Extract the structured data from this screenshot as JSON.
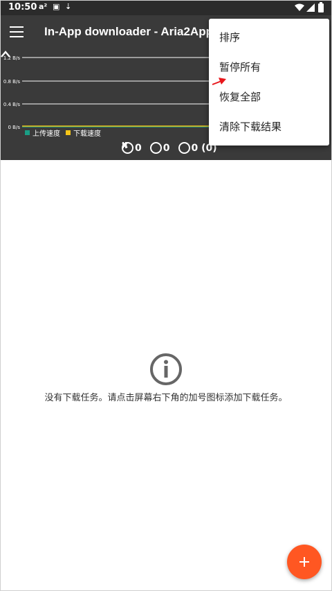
{
  "status_bar": {
    "time": "10:50",
    "icons": [
      "a2-icon",
      "font-icon",
      "download-arrow-icon",
      "wifi-icon",
      "signal-icon",
      "battery-icon"
    ]
  },
  "app_bar": {
    "title": "In-App downloader - Aria2App"
  },
  "chart_data": {
    "type": "line",
    "y_ticks": [
      "1.2 B/s",
      "0.8 B/s",
      "0.4 B/s",
      "0 B/s"
    ],
    "series": [
      {
        "name": "上传速度",
        "color": "#1a9e85",
        "values": [
          0,
          0
        ]
      },
      {
        "name": "下载速度",
        "color": "#f5c518",
        "values": [
          0,
          0
        ]
      }
    ],
    "grid": true,
    "legend": "bottom-left"
  },
  "counters": [
    {
      "icon": "play-icon",
      "value": "0"
    },
    {
      "icon": "pause-icon",
      "value": "0"
    },
    {
      "icon": "cancel-icon",
      "value": "0 (0)"
    }
  ],
  "menu": {
    "items": [
      {
        "label": "排序"
      },
      {
        "label": "暂停所有"
      },
      {
        "label": "恢复全部"
      },
      {
        "label": "清除下载结果"
      }
    ]
  },
  "empty_state": {
    "message": "没有下载任务。请点击屏幕右下角的加号图标添加下载任务。"
  },
  "colors": {
    "app_bar": "#3a3a3a",
    "fab": "#ff5722",
    "annotation_arrow": "#e8161b"
  }
}
